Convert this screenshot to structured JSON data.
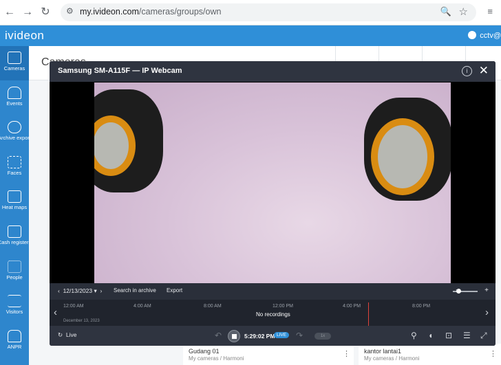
{
  "browser": {
    "url_host": "my.ivideon.com",
    "url_path": "/cameras/groups/own"
  },
  "app": {
    "brand": "ivideon",
    "user": "cctv@"
  },
  "sidebar": {
    "items": [
      {
        "label": "Cameras",
        "icon": "camera-icon"
      },
      {
        "label": "Events",
        "icon": "bell-icon"
      },
      {
        "label": "Archive export",
        "icon": "cloud-download-icon"
      },
      {
        "label": "Faces",
        "icon": "face-scan-icon"
      },
      {
        "label": "Heat maps",
        "icon": "heat-map-icon"
      },
      {
        "label": "Cash registers",
        "icon": "cash-register-icon"
      },
      {
        "label": "People",
        "icon": "people-icon"
      },
      {
        "label": "Visitors",
        "icon": "swap-arrows-icon"
      },
      {
        "label": "ANPR",
        "icon": "car-icon"
      }
    ]
  },
  "page": {
    "title": "Cameras",
    "cards": [
      {
        "title": "Gudang 01",
        "path": "My cameras / Harmoni"
      },
      {
        "title": "kantor lantai1",
        "path": "My cameras / Harmoni"
      }
    ]
  },
  "modal": {
    "title": "Samsung SM-A115F — IP Webcam",
    "date": "12/13/2023",
    "search_archive": "Search in archive",
    "export": "Export",
    "timeline_ticks": [
      "12:00 AM",
      "4:00 AM",
      "8:00 AM",
      "12:00 PM",
      "4:00 PM",
      "8:00 PM"
    ],
    "timeline_date": "December 13, 2023",
    "no_recordings": "No recordings",
    "live_label": "Live",
    "current_time": "5:29:02 PM",
    "live_badge": "LIVE",
    "speed": "1x"
  },
  "colors": {
    "header_blue": "#2f8fd8",
    "sidebar_blue": "#2e86cd",
    "player_dark": "#2f3440",
    "timeline_marker": "#e0443b"
  }
}
